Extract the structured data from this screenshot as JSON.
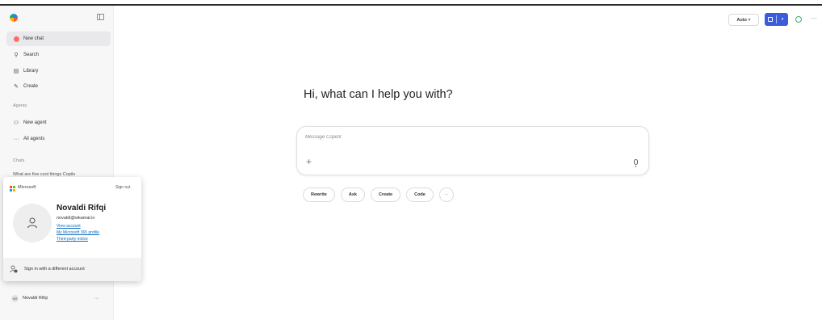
{
  "sidebar": {
    "nav": [
      {
        "label": "New chat",
        "icon": "new-chat-icon"
      },
      {
        "label": "Search",
        "icon": "search-icon"
      },
      {
        "label": "Library",
        "icon": "library-icon"
      },
      {
        "label": "Create",
        "icon": "create-icon"
      }
    ],
    "agents_label": "Agents",
    "agents": [
      {
        "label": "New agent",
        "icon": "agent-icon"
      },
      {
        "label": "All agents",
        "icon": "more-icon"
      }
    ],
    "chats_label": "Chats",
    "chats": [
      "What are five cool things Copilo"
    ],
    "user_name": "Novaldi Rifqi",
    "user_initials": "NR"
  },
  "account_popup": {
    "brand": "Microsoft",
    "sign_out": "Sign out",
    "name": "Novaldi Rifqi",
    "email": "novaldi@wkamal.io",
    "links": [
      "View account",
      "My Microsoft 365 profile",
      "Third-party notice"
    ],
    "other_account": "Sign in with a different account"
  },
  "main": {
    "greeting": "Hi, what can I help you with?",
    "composer_placeholder": "Message Copilot",
    "chips": [
      "Rewrite",
      "Ask",
      "Create",
      "Code"
    ],
    "more_chip": "···"
  },
  "topbar": {
    "mode": "Auto ˅",
    "blue_button_suffix": "▾",
    "more": "···"
  },
  "colors": {
    "accent_blue": "#3b5bdb",
    "status_green": "#2fb36b",
    "link_blue": "#0f6cbd"
  }
}
